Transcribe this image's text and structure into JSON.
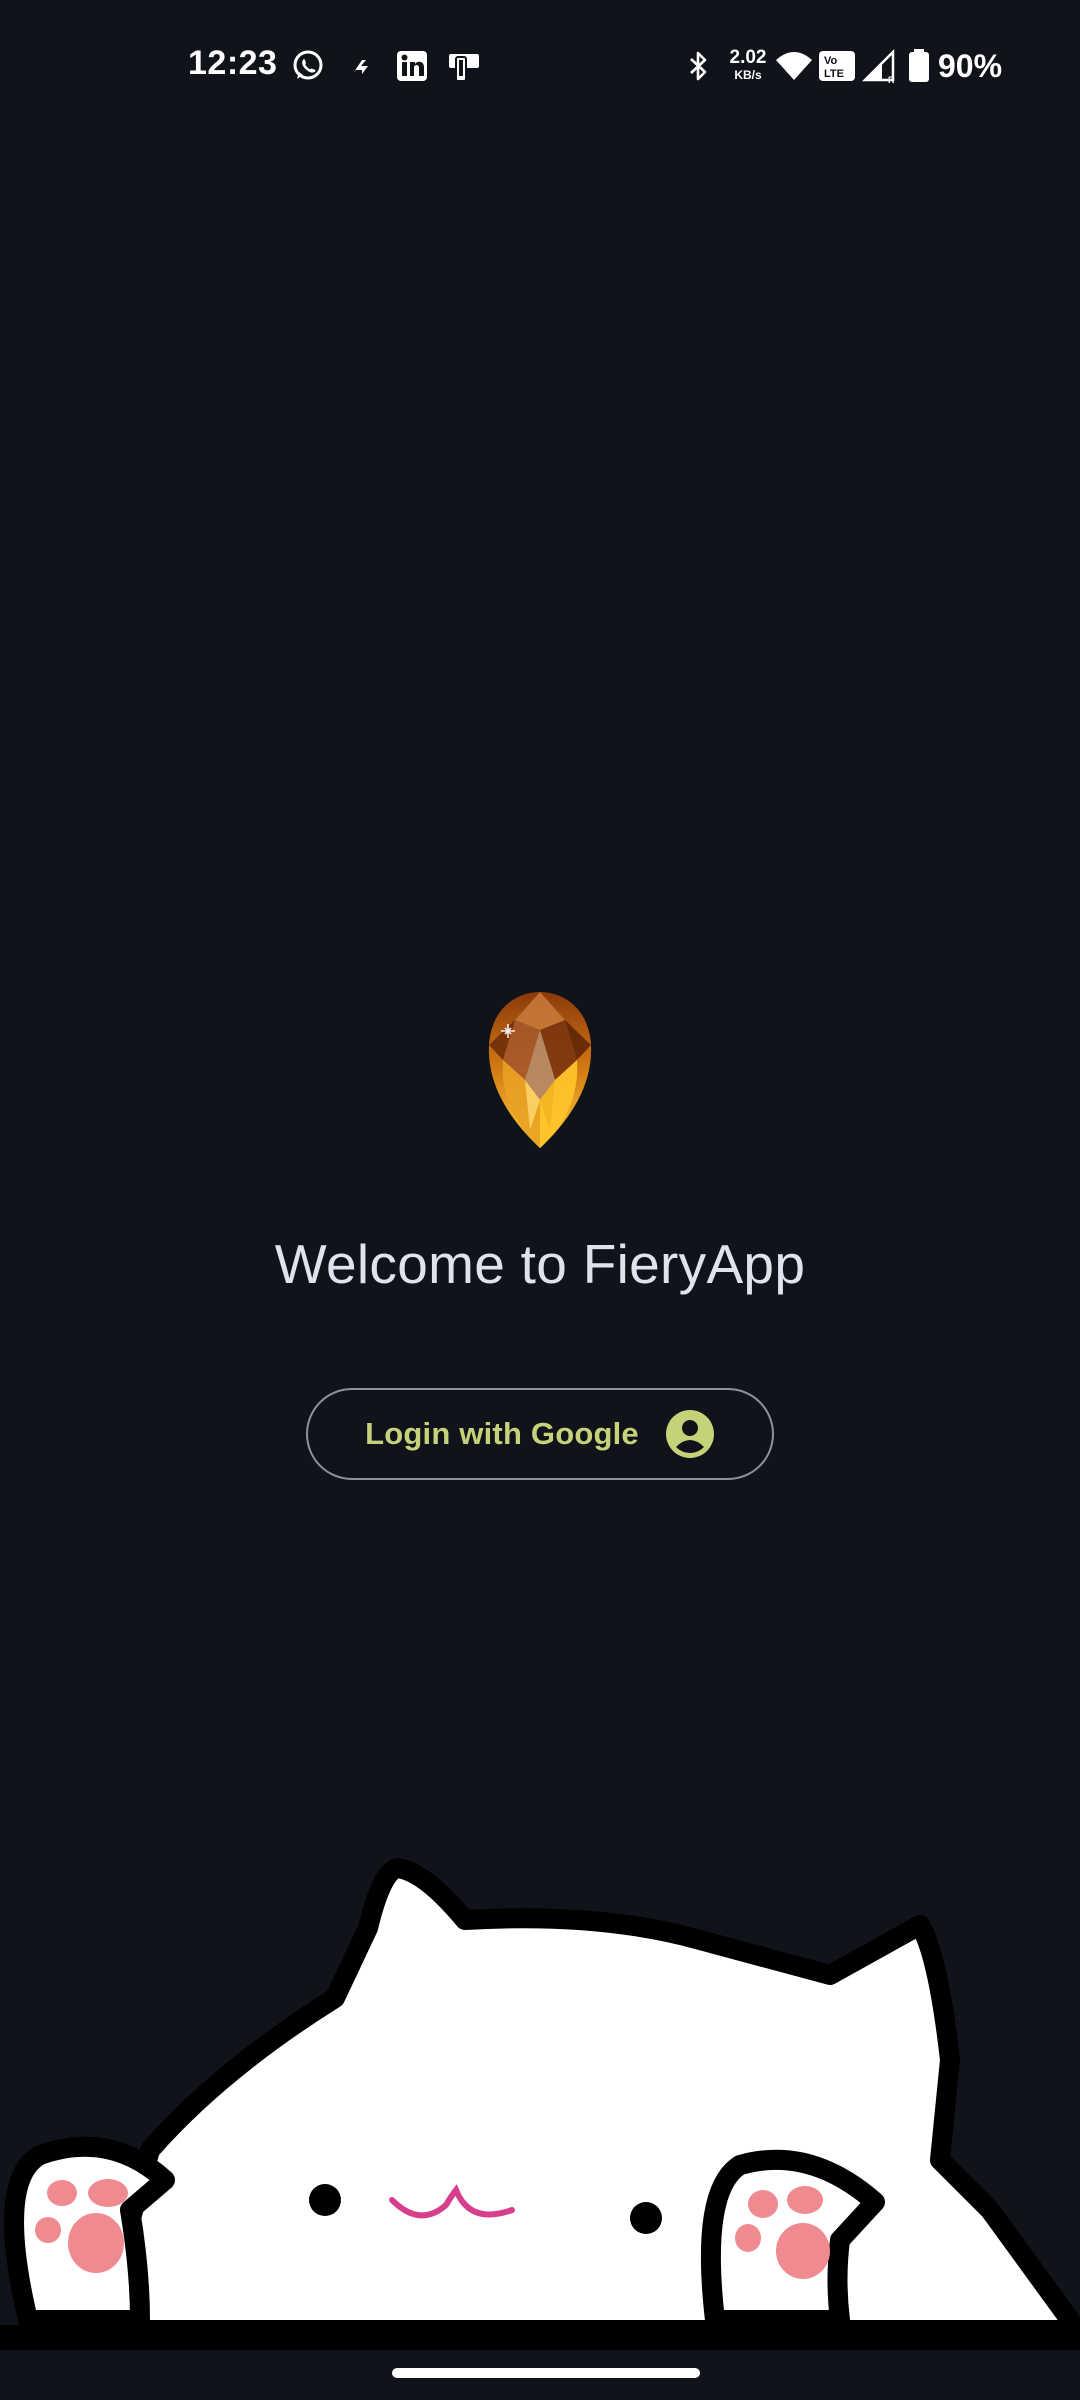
{
  "status_bar": {
    "time": "12:23",
    "notification_icons": [
      "whatsapp-icon",
      "fiery-notification-icon",
      "linkedin-icon",
      "device-sync-icon"
    ],
    "system_icons": [
      "bluetooth-icon",
      "wifi-icon",
      "volte-icon",
      "cell-signal-icon",
      "battery-icon"
    ],
    "network_speed_value": "2.02",
    "network_speed_unit": "KB/s",
    "volte_label": "Vo LTE",
    "battery": "90%"
  },
  "main": {
    "logo_icon": "amber-gem-icon",
    "welcome_text": "Welcome to FieryApp",
    "login_button_label": "Login with Google",
    "login_button_icon": "account-circle-icon",
    "illustration": "bongo-cat-illustration"
  },
  "colors": {
    "background": "#10131a",
    "welcome_text": "#dfe3ee",
    "accent": "#c6d27a",
    "button_border": "#8e929c",
    "cat_paw_pink": "#ee8a90",
    "cat_mouth": "#d63f8c"
  }
}
